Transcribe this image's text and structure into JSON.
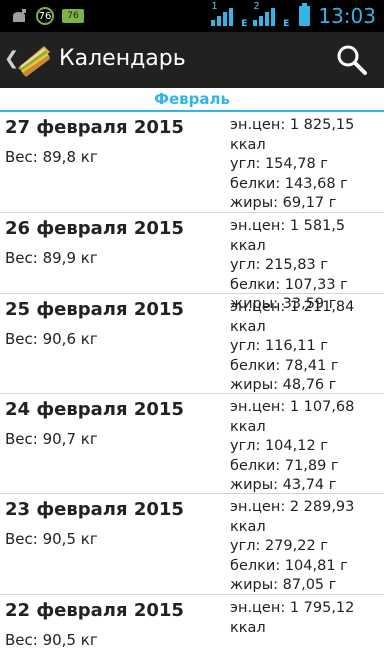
{
  "status_bar": {
    "sim1": "1",
    "sim2": "2",
    "network": "E",
    "time": "13:03",
    "badge1": "76",
    "badge2": "76"
  },
  "action_bar": {
    "title": "Календарь"
  },
  "section": {
    "label": "Февраль"
  },
  "entries": [
    {
      "date": "27 февраля 2015",
      "weight": "Вес: 89,8 кг",
      "energy": "эн.цен: 1 825,15 ккал",
      "carbs": "угл: 154,78 г",
      "proteins": "белки: 143,68 г",
      "fats": "жиры: 69,17 г"
    },
    {
      "date": "26 февраля 2015",
      "weight": "Вес: 89,9 кг",
      "energy": "эн.цен: 1 581,5 ккал",
      "carbs": "угл: 215,83 г",
      "proteins": "белки: 107,33 г",
      "fats": "жиры: 33,59 г"
    },
    {
      "date": "25 февраля 2015",
      "weight": "Вес: 90,6 кг",
      "energy": "эн.цен: 1 211,84 ккал",
      "carbs": "угл: 116,11 г",
      "proteins": "белки: 78,41 г",
      "fats": "жиры: 48,76 г"
    },
    {
      "date": "24 февраля 2015",
      "weight": "Вес: 90,7 кг",
      "energy": "эн.цен: 1 107,68 ккал",
      "carbs": "угл: 104,12 г",
      "proteins": "белки: 71,89 г",
      "fats": "жиры: 43,74 г"
    },
    {
      "date": "23 февраля 2015",
      "weight": "Вес: 90,5 кг",
      "energy": "эн.цен: 2 289,93 ккал",
      "carbs": "угл: 279,22 г",
      "proteins": "белки: 104,81 г",
      "fats": "жиры: 87,05 г"
    },
    {
      "date": "22 февраля 2015",
      "weight": "Вес: 90,5 кг",
      "energy": "эн.цен: 1 795,12 ккал",
      "carbs": "",
      "proteins": "",
      "fats": ""
    }
  ]
}
